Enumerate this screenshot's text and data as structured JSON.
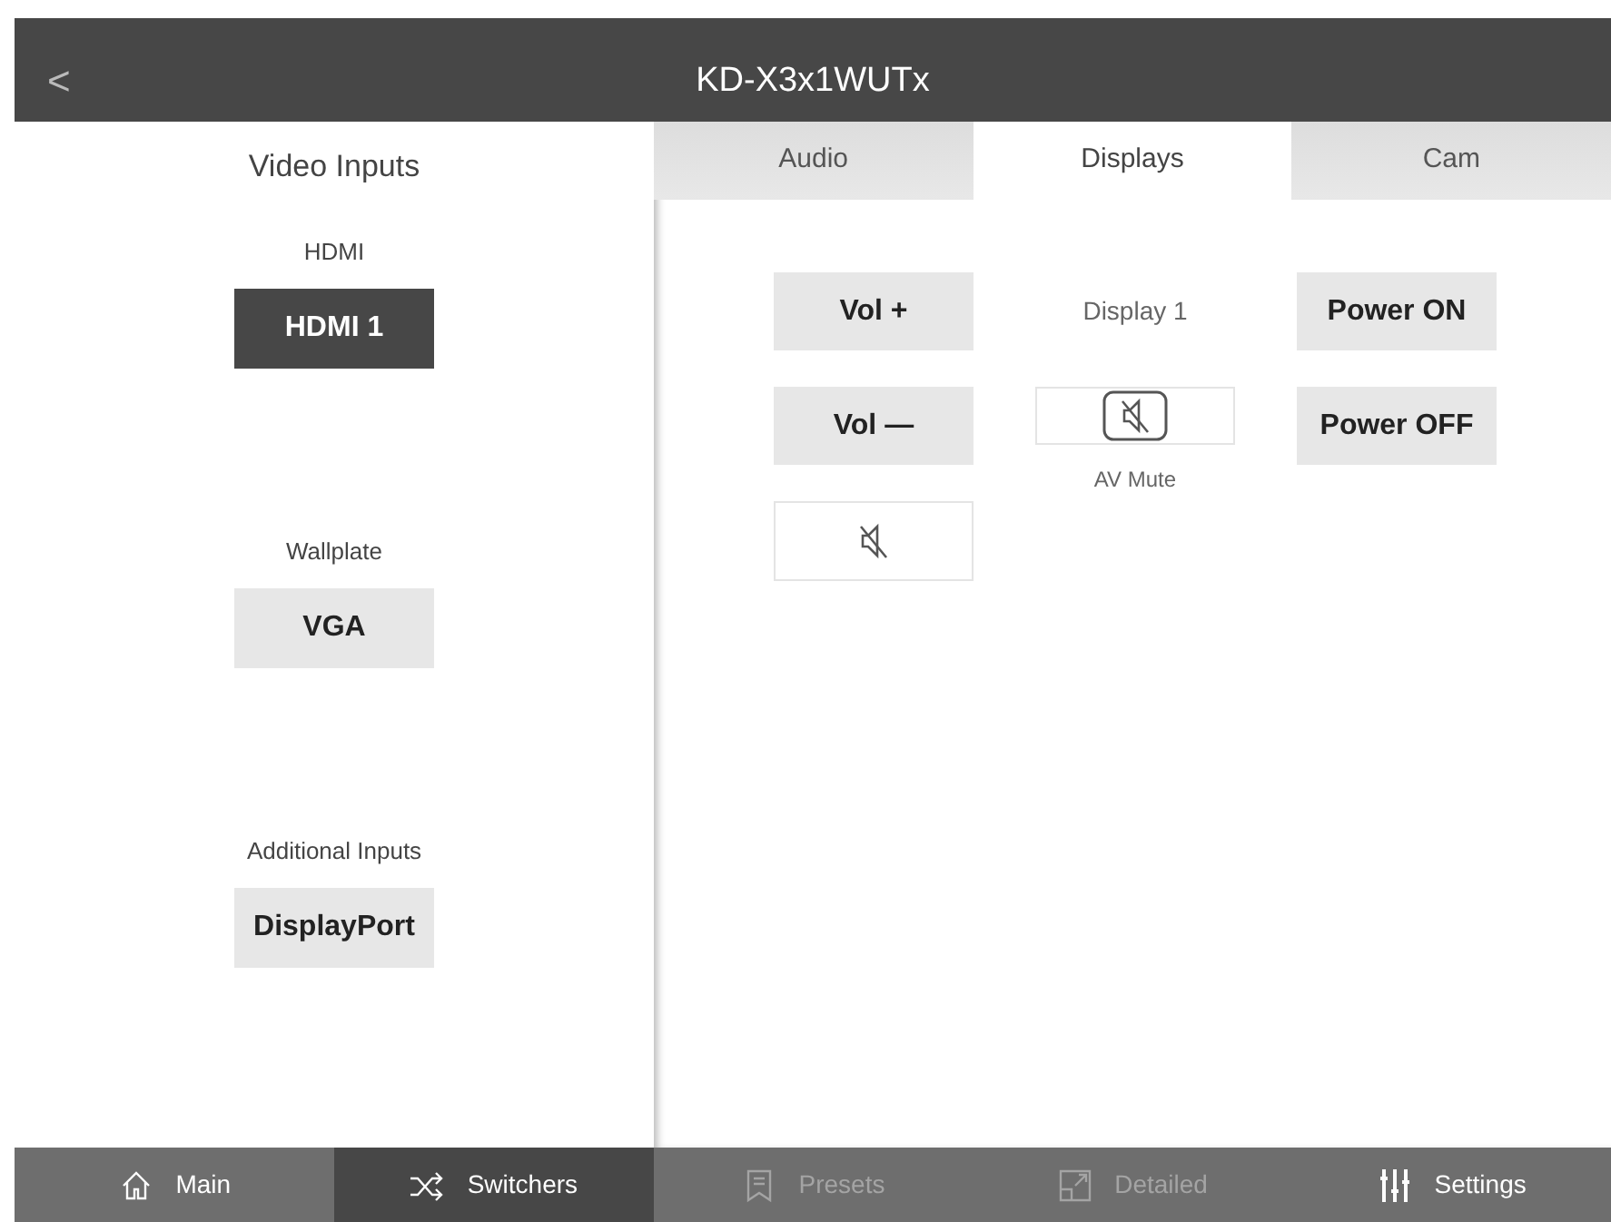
{
  "header": {
    "back": "<",
    "title": "KD-X3x1WUTx"
  },
  "inputs": {
    "title": "Video Inputs",
    "groups": [
      {
        "label": "HDMI",
        "buttons": [
          {
            "label": "HDMI 1",
            "selected": true
          }
        ]
      },
      {
        "label": "Wallplate",
        "buttons": [
          {
            "label": "VGA",
            "selected": false
          }
        ]
      },
      {
        "label": "Additional Inputs",
        "buttons": [
          {
            "label": "DisplayPort",
            "selected": false
          }
        ]
      }
    ]
  },
  "tabs": [
    {
      "label": "Audio",
      "selected": false
    },
    {
      "label": "Displays",
      "selected": true
    },
    {
      "label": "Cam",
      "selected": false
    }
  ],
  "display": {
    "title": "Display 1",
    "vol_up": "Vol +",
    "vol_down": "Vol —",
    "power_on": "Power ON",
    "power_off": "Power OFF",
    "av_mute_label": "AV Mute"
  },
  "nav": [
    {
      "label": "Main",
      "kind": "home",
      "selected": false,
      "disabled": false
    },
    {
      "label": "Switchers",
      "kind": "shuffle",
      "selected": true,
      "disabled": false
    },
    {
      "label": "Presets",
      "kind": "bookmark",
      "selected": false,
      "disabled": true
    },
    {
      "label": "Detailed",
      "kind": "expand",
      "selected": false,
      "disabled": true
    },
    {
      "label": "Settings",
      "kind": "sliders",
      "selected": false,
      "disabled": false
    }
  ]
}
